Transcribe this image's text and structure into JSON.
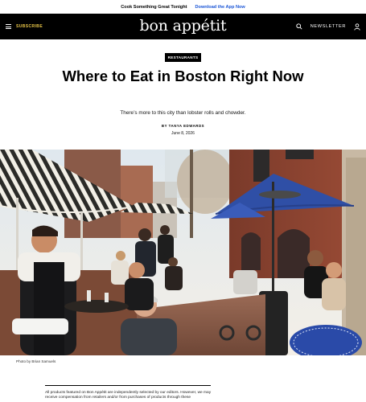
{
  "promo": {
    "text": "Cook Something Great Tonight",
    "link": "Download the App Now",
    "link_color": "#1a55d6"
  },
  "nav": {
    "subscribe": "SUBSCRIBE",
    "logo": "bon appétit",
    "newsletter": "NEWSLETTER",
    "icons": [
      "menu-icon",
      "search-icon",
      "user-icon"
    ],
    "subscribe_color": "#e8c547",
    "background": "#000000"
  },
  "article": {
    "tag": "RESTAURANTS",
    "headline": "Where to Eat in Boston Right Now",
    "dek": "There’s more to this city than lobster rolls and chowder.",
    "byline": "BY TANYA EDWARDS",
    "date": "June 8, 2026"
  },
  "hero": {
    "alt": "Outdoor sidewalk patio with striped umbrellas and diners",
    "credit": "Photo by Brian Samuels"
  },
  "disclaimer": "All products featured on Bon Appétit are independently selected by our editors. However, we may receive compensation from retailers and/or from purchases of products through these"
}
